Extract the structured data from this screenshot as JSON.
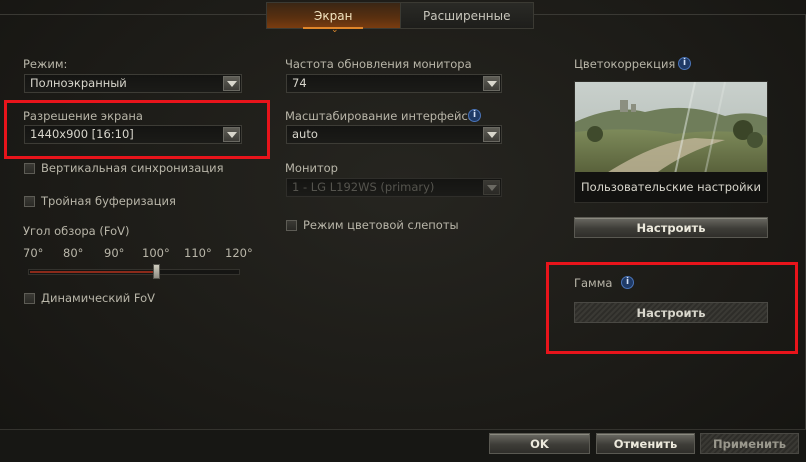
{
  "tabs": [
    {
      "label": "Экран",
      "active": true
    },
    {
      "label": "Расширенные",
      "active": false
    }
  ],
  "left": {
    "mode_label": "Режим:",
    "mode_value": "Полноэкранный",
    "resolution_label": "Разрешение экрана",
    "resolution_value": "1440x900 [16:10]",
    "vsync_label": "Вертикальная синхронизация",
    "triple_buffer_label": "Тройная буферизация",
    "fov_label": "Угол обзора (FoV)",
    "fov_ticks": [
      "70°",
      "80°",
      "90°",
      "100°",
      "110°",
      "120°"
    ],
    "fov_value": "100",
    "dynamic_fov_label": "Динамический FoV"
  },
  "middle": {
    "refresh_label": "Частота обновления монитора",
    "refresh_value": "74",
    "ui_scale_label": "Масштабирование интерфейса",
    "ui_scale_value": "auto",
    "monitor_label": "Монитор",
    "monitor_value": "1 - LG L192WS (primary)",
    "colorblind_label": "Режим цветовой слепоты"
  },
  "right": {
    "color_correction_label": "Цветокоррекция",
    "preview_caption": "Пользовательские настройки",
    "configure_button": "Настроить",
    "gamma_label": "Гамма",
    "gamma_button": "Настроить"
  },
  "footer": {
    "ok": "OK",
    "cancel": "Отменить",
    "apply": "Применить"
  },
  "colors": {
    "highlight": "#e8141b",
    "tab_active": "#5a3010",
    "info": "#1f3a66"
  }
}
